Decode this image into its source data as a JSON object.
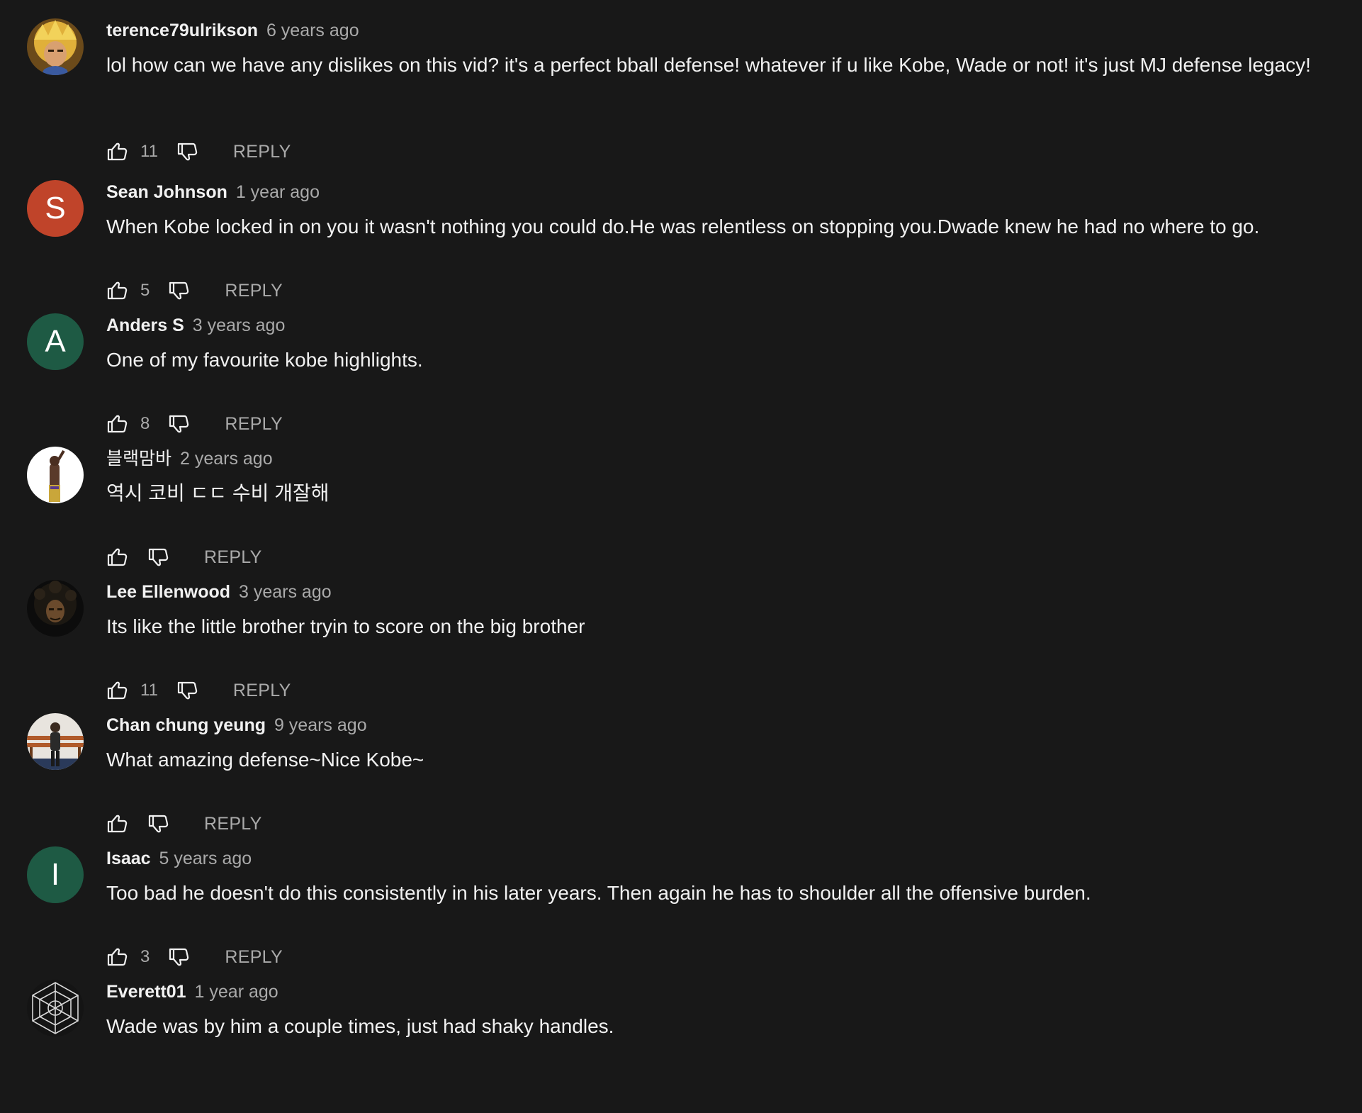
{
  "colors": {
    "background": "#181818",
    "text": "#f1f1f1",
    "secondary_text": "#aaaaaa",
    "avatar_sean": "#c0442a",
    "avatar_anders": "#1e5a44",
    "avatar_isaac": "#1e5a44"
  },
  "icons": {
    "like": "thumbs-up-icon",
    "dislike": "thumbs-down-icon"
  },
  "comments": [
    {
      "author": "terence79ulrikson",
      "time": "6 years ago",
      "text": "lol how can we have any dislikes on this vid? it's a perfect bball defense! whatever if u like Kobe, Wade or not! it's just MJ defense legacy!",
      "likes": "11",
      "reply": "REPLY"
    },
    {
      "author": "Sean Johnson",
      "time": "1 year ago",
      "text": "When Kobe locked in on you it wasn't nothing you could do.He was relentless on stopping you.Dwade knew he had no where to go.",
      "likes": "5",
      "reply": "REPLY",
      "avatar_letter": "S"
    },
    {
      "author": "Anders S",
      "time": "3 years ago",
      "text": "One of my favourite kobe highlights.",
      "likes": "8",
      "reply": "REPLY",
      "avatar_letter": "A"
    },
    {
      "author": "블랙맘바",
      "time": "2 years ago",
      "text": "역시 코비 ㄷㄷ 수비 개잘해",
      "likes": "",
      "reply": "REPLY"
    },
    {
      "author": "Lee Ellenwood",
      "time": "3 years ago",
      "text": "Its like the little brother tryin to score on the big brother",
      "likes": "11",
      "reply": "REPLY"
    },
    {
      "author": "Chan chung yeung",
      "time": "9 years ago",
      "text": "What amazing defense~Nice Kobe~",
      "likes": "",
      "reply": "REPLY"
    },
    {
      "author": "Isaac",
      "time": "5 years ago",
      "text": "Too bad he doesn't do this consistently in his later years. Then again he has to shoulder all the offensive burden.",
      "likes": "3",
      "reply": "REPLY",
      "avatar_letter": "I"
    },
    {
      "author": "Everett01",
      "time": "1 year ago",
      "text": "Wade was by him a couple times, just had shaky handles.",
      "likes": "",
      "reply": "REPLY"
    }
  ]
}
